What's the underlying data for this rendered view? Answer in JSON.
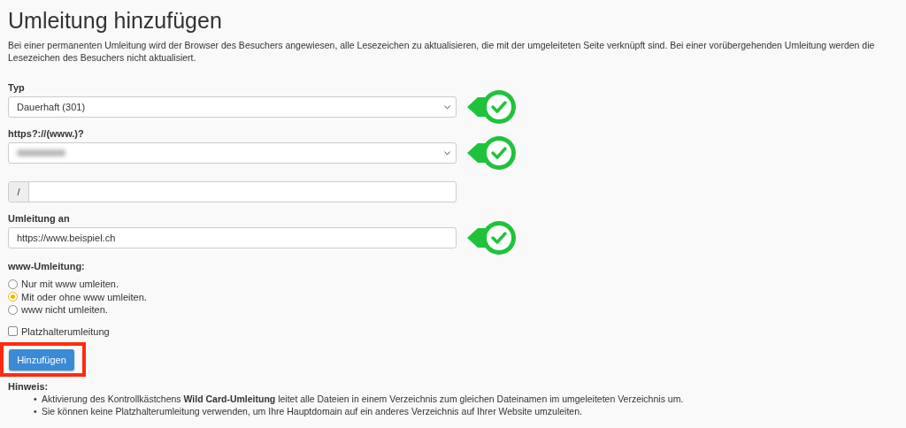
{
  "title": "Umleitung hinzufügen",
  "description": "Bei einer permanenten Umleitung wird der Browser des Besuchers angewiesen, alle Lesezeichen zu aktualisieren, die mit der umgeleiteten Seite verknüpft sind. Bei einer vorübergehenden Umleitung werden die Lesezeichen des Besuchers nicht aktualisiert.",
  "fields": [
    {
      "kind": "select",
      "label": "Typ",
      "value": "Dauerhaft (301)",
      "verified": true
    },
    {
      "kind": "blurred-select",
      "label": "https?://(www.)?",
      "verified": true
    },
    {
      "kind": "prefixed",
      "prefix": "/",
      "verified": false
    },
    {
      "kind": "input",
      "label": "Umleitung an",
      "value": "https://www.beispiel.ch",
      "verified": true
    }
  ],
  "www_redirect": {
    "label": "www-Umleitung:",
    "options": [
      {
        "label": "Nur mit www umleiten.",
        "selected": false
      },
      {
        "label": "Mit oder ohne www umleiten.",
        "selected": true
      },
      {
        "label": "www nicht umleiten.",
        "selected": false
      }
    ]
  },
  "wildcard": {
    "label": "Platzhalterumleitung",
    "checked": false
  },
  "submit": {
    "label": "Hinzufügen",
    "highlighted": true
  },
  "note": {
    "title": "Hinweis:",
    "bullet": "•",
    "items": [
      "Aktivierung des Kontrollkästchens **Wild Card-Umleitung** leitet alle Dateien in einem Verzeichnis zum gleichen Dateinamen im umgeleiteten Verzeichnis um.",
      "Sie können keine Platzhalterumleitung verwenden, um Ihre Hauptdomain auf ein anderes Verzeichnis auf Ihrer Website umzuleiten."
    ]
  }
}
